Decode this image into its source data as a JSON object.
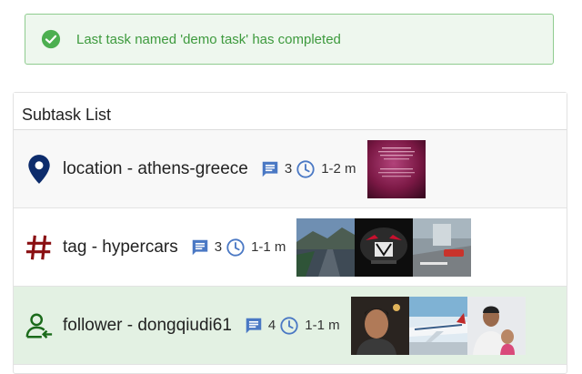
{
  "alert": {
    "message": "Last task named 'demo task' has completed",
    "icon": "check-circle-icon",
    "color": "#3d9a3d"
  },
  "panel": {
    "title": "Subtask List"
  },
  "subtasks": [
    {
      "icon": "location-pin-icon",
      "icon_color": "#0d2c6c",
      "name": "location - athens-greece",
      "comments": "3",
      "duration": "1-2 m",
      "thumbnails": [
        "poster-image"
      ]
    },
    {
      "icon": "hashtag-icon",
      "icon_color": "#8a0f12",
      "name": "tag - hypercars",
      "comments": "3",
      "duration": "1-1 m",
      "thumbnails": [
        "road-image",
        "car-front-image",
        "street-image"
      ]
    },
    {
      "icon": "person-follower-icon",
      "icon_color": "#1b6b1b",
      "name": "follower - dongqiudi61",
      "comments": "4",
      "duration": "1-1 m",
      "thumbnails": [
        "selfie-image",
        "airplane-image",
        "family-photo-image"
      ]
    }
  ]
}
